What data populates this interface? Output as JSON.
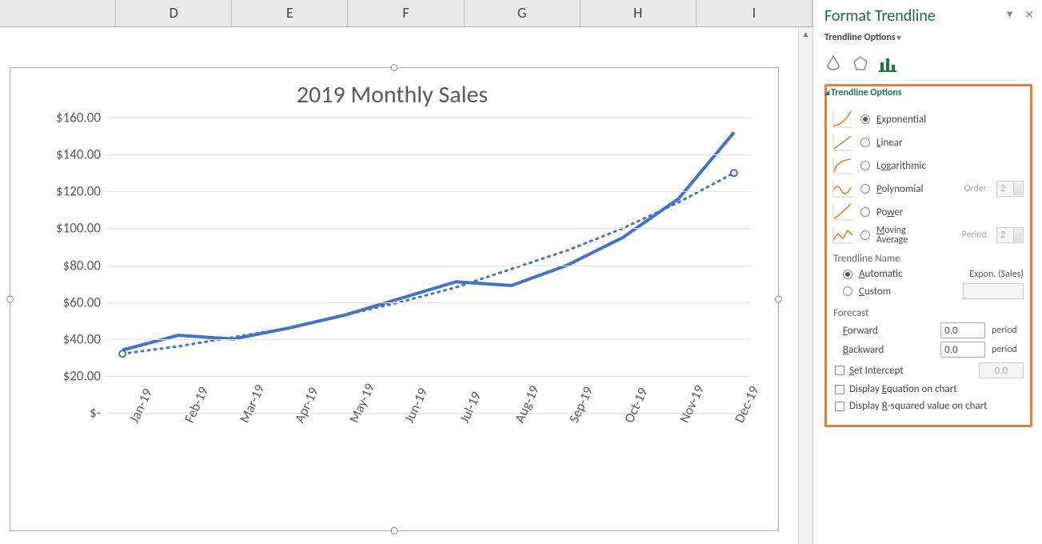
{
  "columns": [
    "D",
    "E",
    "F",
    "G",
    "H",
    "I"
  ],
  "chart_data": {
    "type": "line",
    "title": "2019 Monthly Sales",
    "ylabel": "",
    "xlabel": "",
    "ylim": [
      0,
      160
    ],
    "y_ticks": [
      "$-",
      "$20.00",
      "$40.00",
      "$60.00",
      "$80.00",
      "$100.00",
      "$120.00",
      "$140.00",
      "$160.00"
    ],
    "categories": [
      "Jan-19",
      "Feb-19",
      "Mar-19",
      "Apr-19",
      "May-19",
      "Jun-19",
      "Jul-19",
      "Aug-19",
      "Sep-19",
      "Oct-19",
      "Nov-19",
      "Dec-19"
    ],
    "series": [
      {
        "name": "Sales",
        "values": [
          34,
          42,
          40,
          46,
          53,
          62,
          71,
          69,
          80,
          95,
          116,
          152
        ]
      },
      {
        "name": "Expon. (Sales)",
        "values": [
          32,
          36,
          41,
          46,
          53,
          60,
          68,
          78,
          88,
          100,
          114,
          130
        ],
        "is_trendline": true
      }
    ]
  },
  "pane": {
    "title": "Format Trendline",
    "subtitle": "Trendline Options",
    "section": "Trendline Options",
    "options": {
      "exponential": "Exponential",
      "linear": "Linear",
      "logarithmic": "Logarithmic",
      "polynomial": "Polynomial",
      "power": "Power",
      "moving": "Moving Average",
      "order_label": "Order",
      "order_value": "2",
      "period_label": "Period",
      "period_value": "2"
    },
    "selected_option": "exponential",
    "name_group": {
      "label": "Trendline Name",
      "automatic": "Automatic",
      "custom": "Custom",
      "auto_value": "Expon. (Sales)"
    },
    "forecast": {
      "label": "Forecast",
      "forward_label": "Forward",
      "forward_value": "0.0",
      "backward_label": "Backward",
      "backward_value": "0.0",
      "unit": "period"
    },
    "intercept": {
      "label": "Set Intercept",
      "value": "0.0"
    },
    "equation_label": "Display Equation on chart",
    "rsquared_label": "Display R-squared value on chart"
  }
}
